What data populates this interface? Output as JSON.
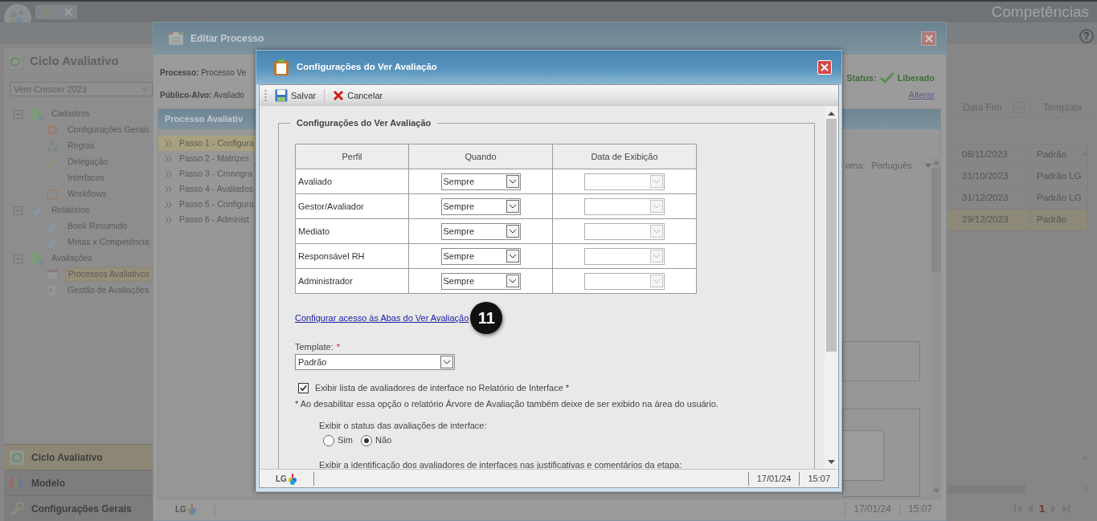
{
  "app": {
    "title": "Competências",
    "help": "?",
    "sidebar": {
      "title": "Ciclo Avaliativo",
      "cycle_select": "Vem Crescer 2023",
      "tree": [
        {
          "label": "Cadastros",
          "expanded": true,
          "children": [
            {
              "label": "Configurações Gerais",
              "selected": false
            },
            {
              "label": "Regras",
              "selected": false
            },
            {
              "label": "Delegação",
              "selected": false
            },
            {
              "label": "Interfaces",
              "selected": false
            },
            {
              "label": "Workflows",
              "selected": false
            }
          ]
        },
        {
          "label": "Relatórios",
          "expanded": true,
          "children": [
            {
              "label": "Book Resumido",
              "selected": false
            },
            {
              "label": "Metas x Competência",
              "selected": false
            }
          ]
        },
        {
          "label": "Avaliações",
          "expanded": true,
          "children": [
            {
              "label": "Processos Avaliativos",
              "selected": true
            },
            {
              "label": "Gestão de Avaliações",
              "selected": false
            }
          ]
        }
      ]
    },
    "modules": [
      {
        "label": "Ciclo Avaliativo",
        "selected": true
      },
      {
        "label": "Modelo",
        "selected": false
      },
      {
        "label": "Configurações Gerais",
        "selected": false
      }
    ],
    "grid": {
      "columns": [
        "Data Fim",
        "Template"
      ],
      "rows": [
        {
          "cells": [
            "08/11/2023",
            "Padrão"
          ],
          "selected": false
        },
        {
          "cells": [
            "31/10/2023",
            "Padrão LG"
          ],
          "selected": false
        },
        {
          "cells": [
            "31/12/2023",
            "Padrão LG"
          ],
          "selected": false
        },
        {
          "cells": [
            "29/12/2023",
            "Padrão"
          ],
          "selected": true
        }
      ]
    },
    "pager": {
      "page": "1"
    }
  },
  "process_window": {
    "title": "Editar Processo",
    "fields": [
      {
        "label": "Processo:",
        "value": "Processo Ve"
      },
      {
        "label": "Público-Alvo:",
        "value": "Avaliado"
      }
    ],
    "status": {
      "label": "Status:",
      "value": "Liberado"
    },
    "change_link": "Alterar",
    "steps_title": "Processo Avaliativ",
    "steps": [
      {
        "label": "Passo 1 - Configura",
        "selected": true
      },
      {
        "label": "Passo 2 - Matrizes",
        "selected": false
      },
      {
        "label": "Passo 3 - Cronogra",
        "selected": false
      },
      {
        "label": "Passo 4 - Avaliados",
        "selected": false
      },
      {
        "label": "Passo 5 - Configura",
        "selected": false
      },
      {
        "label": "Passo 6 - Administ",
        "selected": false
      }
    ],
    "language": {
      "label": "oma:",
      "value": "Português"
    },
    "status_bar": {
      "logo": "LG",
      "date": "17/01/24",
      "time": "15:07"
    }
  },
  "dialog": {
    "title": "Configurações do Ver Avaliação",
    "toolbar": [
      {
        "kind": "save",
        "label": "Salvar"
      },
      {
        "kind": "cancel",
        "label": "Cancelar"
      }
    ],
    "legend": "Configurações do Ver Avaliação",
    "table": {
      "columns": [
        "Perfil",
        "Quando",
        "Data de Exibição"
      ],
      "rows": [
        {
          "profile": "Avaliado",
          "when": "Sempre",
          "date_disabled": true
        },
        {
          "profile": "Gestor/Avaliador",
          "when": "Sempre",
          "date_disabled": true
        },
        {
          "profile": "Mediato",
          "when": "Sempre",
          "date_disabled": true
        },
        {
          "profile": "Responsável RH",
          "when": "Sempre",
          "date_disabled": true
        },
        {
          "profile": "Administrador",
          "when": "Sempre",
          "date_disabled": true
        }
      ]
    },
    "link": "Configurar acesso às Abas do Ver Avaliação",
    "callout": "11",
    "template": {
      "label": "Template:",
      "required_mark": "*",
      "value": "Padrão"
    },
    "interface_list": {
      "label": "Exibir lista de avaliadores de interface no Relatório de Interface *",
      "checked": true
    },
    "note": "* Ao desabilitar essa opção o relatório Árvore de Avaliação também deixe de ser exibido na área do usuário.",
    "status_question": {
      "label": "Exibir o status das avaliações de interface:",
      "options": [
        {
          "label": "Sim",
          "selected": false
        },
        {
          "label": "Não",
          "selected": true
        }
      ]
    },
    "identification_question": "Exibir a identificação dos avaliadores de interfaces nas justificativas e comentários da etapa:",
    "status_bar": {
      "logo": "LG",
      "date": "17/01/24",
      "time": "15:07"
    }
  }
}
